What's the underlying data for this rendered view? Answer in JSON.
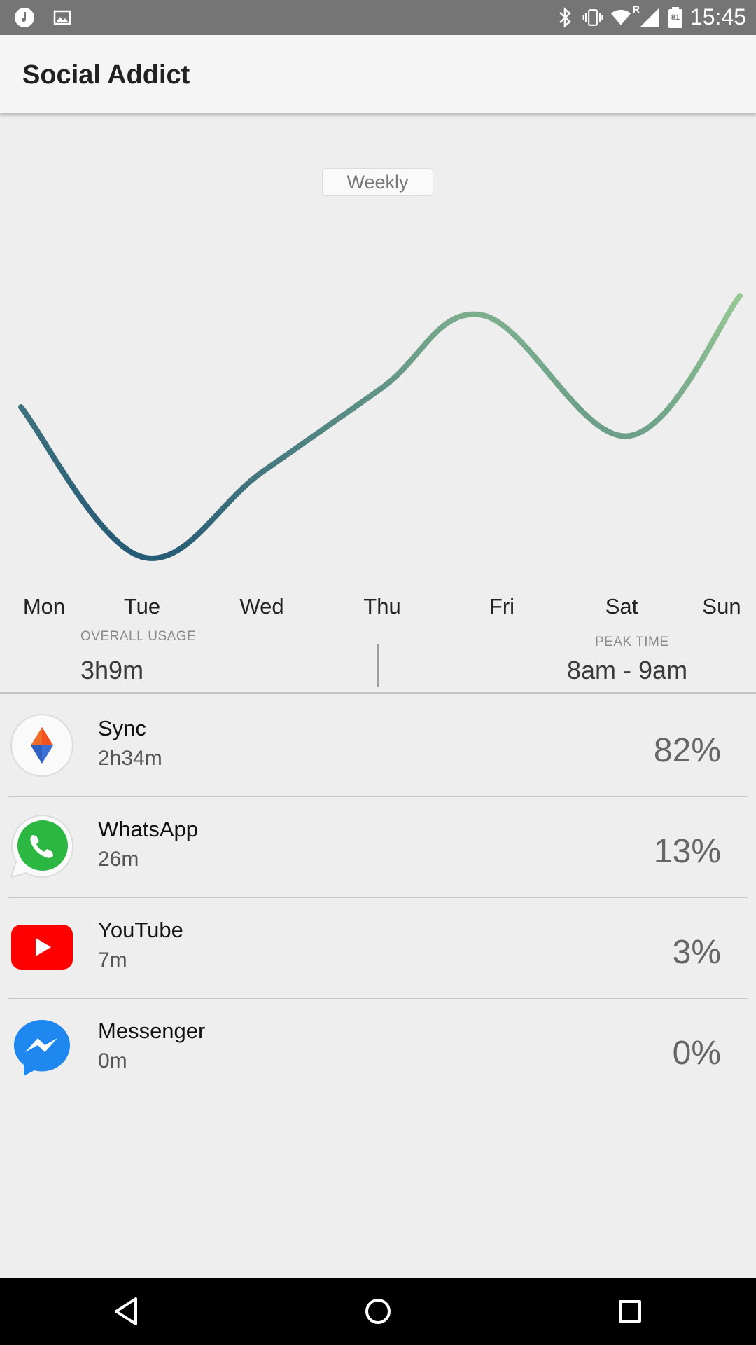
{
  "status_bar": {
    "time": "15:45",
    "battery_level": "81",
    "roaming_indicator": "R",
    "icons": [
      "music-icon",
      "image-icon",
      "bluetooth-icon",
      "vibrate-icon",
      "wifi-icon",
      "signal-icon",
      "battery-icon"
    ]
  },
  "app_bar": {
    "title": "Social Addict"
  },
  "range_selector": {
    "label": "Weekly"
  },
  "chart_data": {
    "type": "line",
    "x": [
      "Mon",
      "Tue",
      "Wed",
      "Thu",
      "Fri",
      "Sat",
      "Sun"
    ],
    "series": [
      {
        "values": [
          0.62,
          0.0,
          0.35,
          0.7,
          1.0,
          0.5,
          1.08
        ]
      }
    ],
    "gradient_colors": [
      "#1b4f72",
      "#97c895"
    ],
    "grid": false,
    "smooth": true
  },
  "stats": {
    "overall_label": "OVERALL USAGE",
    "overall_value": "3h9m",
    "peak_label": "PEAK TIME",
    "peak_value": "8am - 9am"
  },
  "apps": [
    {
      "name": "Sync",
      "time": "2h34m",
      "percent": "82%",
      "icon": "sync-icon"
    },
    {
      "name": "WhatsApp",
      "time": "26m",
      "percent": "13%",
      "icon": "whatsapp-icon"
    },
    {
      "name": "YouTube",
      "time": "7m",
      "percent": "3%",
      "icon": "youtube-icon"
    },
    {
      "name": "Messenger",
      "time": "0m",
      "percent": "0%",
      "icon": "messenger-icon"
    }
  ],
  "nav_bar": {
    "icons": [
      "back-icon",
      "home-icon",
      "recents-icon"
    ]
  },
  "colors": {
    "status_bar": "#757575",
    "app_bar": "#f5f5f5",
    "background": "#eeeeee",
    "nav_bar": "#000000",
    "line_start": "#1b4f72",
    "line_end": "#97c895"
  }
}
